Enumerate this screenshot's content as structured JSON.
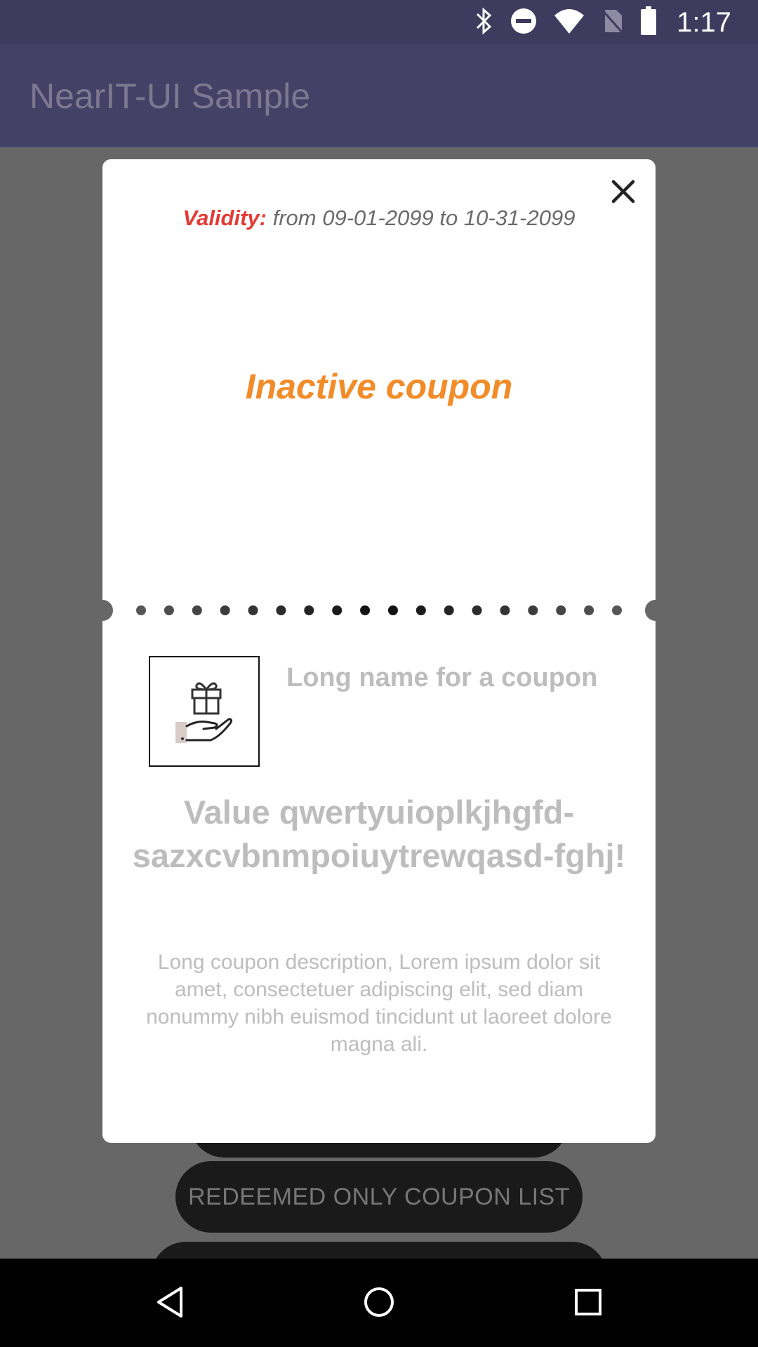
{
  "status_bar": {
    "time": "1:17",
    "icons": [
      "bluetooth-icon",
      "do-not-disturb-icon",
      "wifi-icon",
      "no-sim-icon",
      "battery-icon"
    ]
  },
  "app_bar": {
    "title": "NearIT-UI Sample"
  },
  "background": {
    "buttons": [
      {
        "label": ""
      },
      {
        "label": "REDEEMED ONLY COUPON LIST"
      },
      {
        "label": ""
      }
    ]
  },
  "dialog": {
    "validity_label": "Validity:",
    "validity_range": " from 09-01-2099 to 10-31-2099",
    "status": "Inactive coupon",
    "coupon_name": "Long name for a coupon",
    "coupon_value": "Value qwertyuioplkjhgfd-sazxcvbnmpoiuytrewqasd-fghj!",
    "coupon_description": "Long coupon description, Lorem ipsum dolor sit amet, consectetuer adipiscing elit, sed diam nonummy nibh euismod tincidunt ut laoreet dolore magna ali.",
    "icon": "gift-in-hand-icon",
    "close_icon": "close-icon"
  },
  "nav_bar": {
    "icons": [
      "back-icon",
      "home-icon",
      "recents-icon"
    ]
  },
  "colors": {
    "status_bar": "#3f3b5e",
    "app_bar": "#454066",
    "validity_label": "#e53935",
    "status_text": "#f28c28",
    "overlay": "#676767"
  }
}
